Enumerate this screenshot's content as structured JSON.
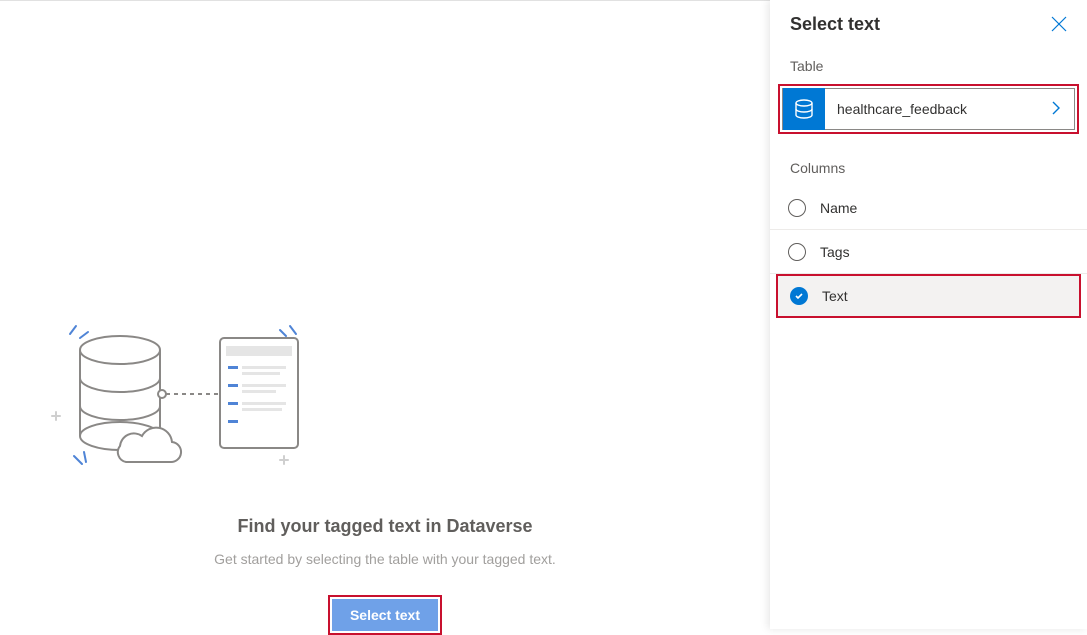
{
  "main": {
    "heading": "Find your tagged text in Dataverse",
    "subtext": "Get started by selecting the table with your tagged text.",
    "button_label": "Select text"
  },
  "panel": {
    "title": "Select text",
    "table_section_label": "Table",
    "selected_table": "healthcare_feedback",
    "columns_section_label": "Columns",
    "columns": [
      {
        "label": "Name",
        "selected": false
      },
      {
        "label": "Tags",
        "selected": false
      },
      {
        "label": "Text",
        "selected": true
      }
    ]
  },
  "colors": {
    "accent": "#0078d4",
    "highlight_border": "#c8102e"
  }
}
